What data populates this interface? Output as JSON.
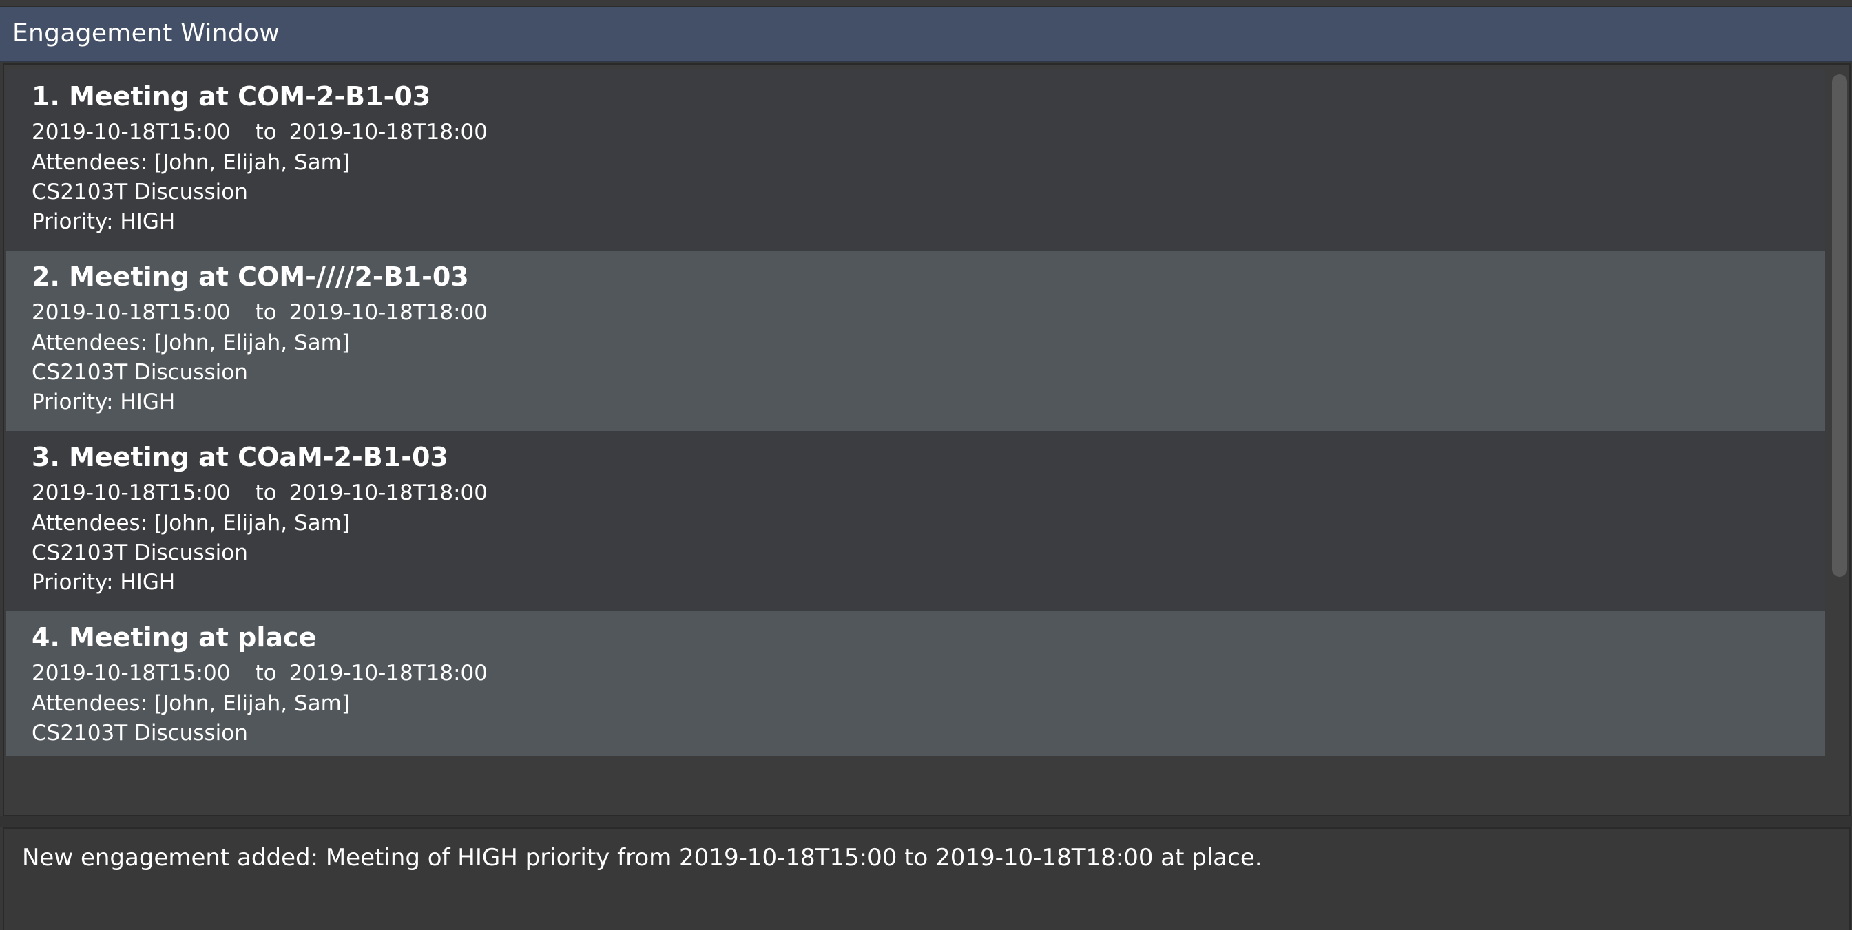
{
  "window": {
    "title": "Engagement Window"
  },
  "engagements": [
    {
      "heading": "1. Meeting at COM-2-B1-03",
      "start": "2019-10-18T15:00",
      "to_label": "to",
      "end": "2019-10-18T18:00",
      "attendees": "Attendees: [John, Elijah, Sam]",
      "description": "CS2103T Discussion",
      "priority": "Priority: HIGH"
    },
    {
      "heading": "2. Meeting at COM-////2-B1-03",
      "start": "2019-10-18T15:00",
      "to_label": "to",
      "end": "2019-10-18T18:00",
      "attendees": "Attendees: [John, Elijah, Sam]",
      "description": "CS2103T Discussion",
      "priority": "Priority: HIGH"
    },
    {
      "heading": "3. Meeting at COaM-2-B1-03",
      "start": "2019-10-18T15:00",
      "to_label": "to",
      "end": "2019-10-18T18:00",
      "attendees": "Attendees: [John, Elijah, Sam]",
      "description": "CS2103T Discussion",
      "priority": "Priority: HIGH"
    },
    {
      "heading": "4. Meeting at place",
      "start": "2019-10-18T15:00",
      "to_label": "to",
      "end": "2019-10-18T18:00",
      "attendees": "Attendees: [John, Elijah, Sam]",
      "description": "CS2103T Discussion"
    }
  ],
  "result": {
    "message": "New engagement added: Meeting of HIGH priority from 2019-10-18T15:00 to 2019-10-18T18:00 at place."
  },
  "colors": {
    "title_bar": "#435067",
    "card_dark": "#3c3d40",
    "card_light": "#51575b",
    "panel_background": "#383838",
    "text": "#ffffff"
  }
}
